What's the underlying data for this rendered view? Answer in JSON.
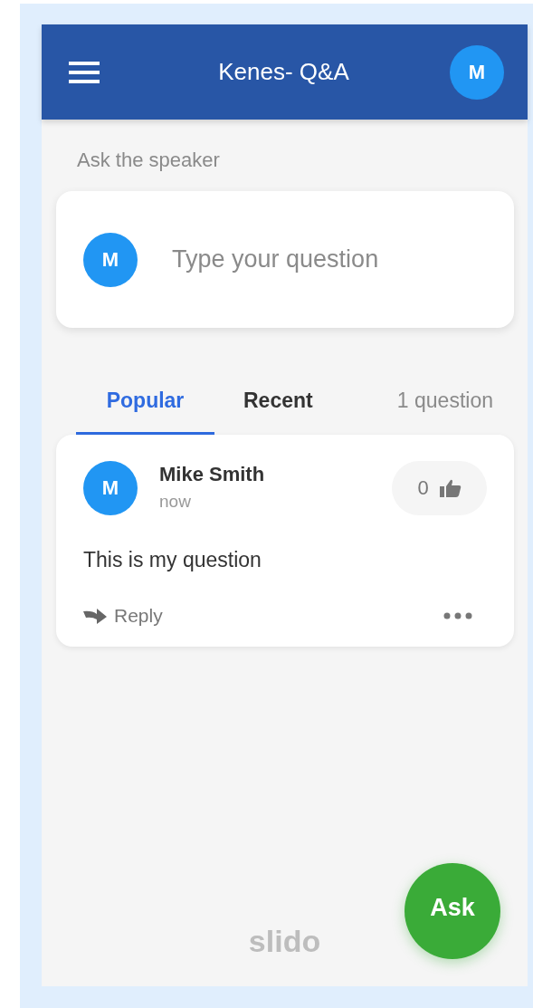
{
  "header": {
    "title": "Kenes- Q&A",
    "avatar": "M"
  },
  "ask_label": "Ask the speaker",
  "question_input": {
    "avatar": "M",
    "placeholder": "Type your question"
  },
  "tabs": [
    {
      "label": "Popular",
      "selected": true
    },
    {
      "label": "Recent",
      "selected": false
    }
  ],
  "question_count": "1 question",
  "questions": [
    {
      "avatar": "M",
      "author": "Mike Smith",
      "time": "now",
      "votes": "0",
      "text": "This is my question",
      "reply": "Reply"
    }
  ],
  "footer_logo": "slido",
  "ask_button": "Ask"
}
